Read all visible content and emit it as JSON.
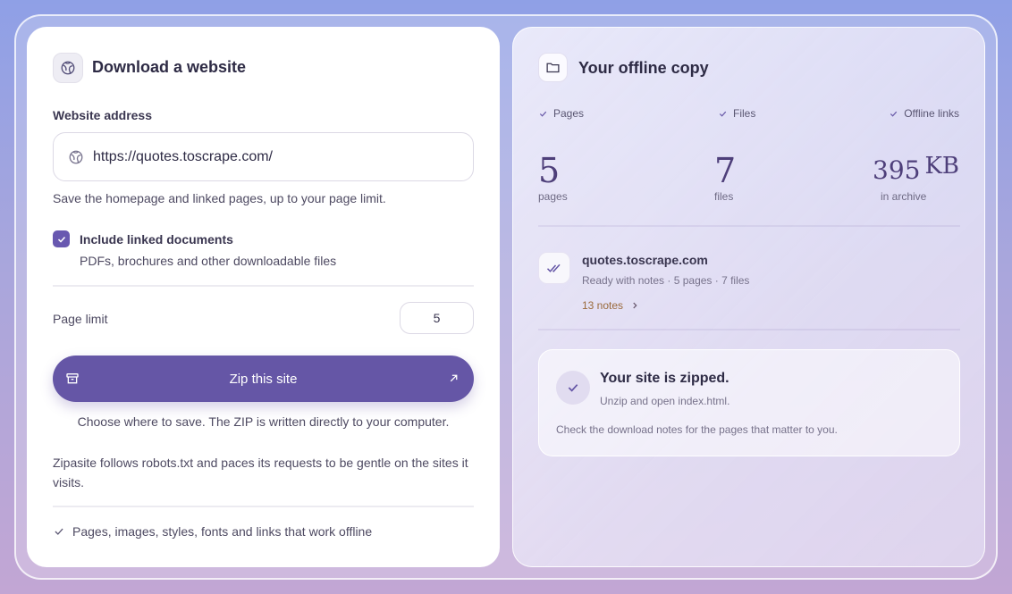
{
  "download": {
    "title": "Download a website",
    "address_label": "Website address",
    "url_value": "https://quotes.toscrape.com/",
    "url_hint": "Save the homepage and linked pages, up to your page limit.",
    "include_docs_label": "Include linked documents",
    "include_docs_desc": "PDFs, brochures and other downloadable files",
    "include_docs_checked": true,
    "page_limit_label": "Page limit",
    "page_limit_value": "5",
    "zip_button_label": "Zip this site",
    "save_note": "Choose where to save. The ZIP is written directly to your computer.",
    "robots_note": "Zipasite follows robots.txt and paces its requests to be gentle on the sites it visits.",
    "feature_note": "Pages, images, styles, fonts and links that work offline"
  },
  "offline": {
    "title": "Your offline copy",
    "checks": [
      "Pages",
      "Files",
      "Offline links"
    ],
    "stats": {
      "pages_value": "5",
      "pages_label": "pages",
      "files_value": "7",
      "files_label": "files",
      "size_value": "395",
      "size_unit": "KB",
      "size_label": "in archive"
    },
    "site": {
      "domain": "quotes.toscrape.com",
      "status": "Ready with notes · 5 pages · 7 files",
      "notes_link": "13 notes"
    },
    "zipped": {
      "title": "Your site is zipped.",
      "subtitle": "Unzip and open index.html.",
      "note": "Check the download notes for the pages that matter to you."
    }
  },
  "colors": {
    "accent": "#6556a6",
    "notes_link": "#9a6a3c"
  }
}
